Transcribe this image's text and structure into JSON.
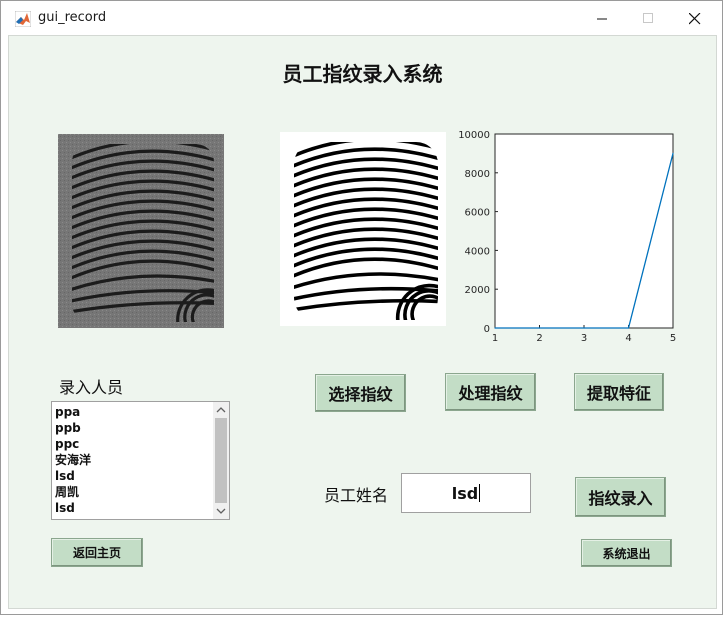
{
  "window": {
    "title": "gui_record"
  },
  "heading": "员工指纹录入系统",
  "buttons": {
    "select": "选择指纹",
    "process": "处理指纹",
    "extract": "提取特征",
    "enroll": "指纹录入",
    "back": "返回主页",
    "exit": "系统退出"
  },
  "labels": {
    "enrolled_staff": "录入人员",
    "employee_name": "员工姓名"
  },
  "name_field": {
    "value": "lsd"
  },
  "staff_list": [
    "ppa",
    "ppb",
    "ppc",
    "安海洋",
    "lsd",
    "周凯",
    "lsd"
  ],
  "chart_data": {
    "type": "line",
    "x": [
      1,
      2,
      3,
      4,
      5
    ],
    "series": [
      {
        "values": [
          0,
          0,
          0,
          0,
          9000
        ],
        "color": "#0072bd"
      }
    ],
    "title": "",
    "xlabel": "",
    "ylabel": "",
    "xlim": [
      1,
      5
    ],
    "ylim": [
      0,
      10000
    ],
    "xticks": [
      "1",
      "2",
      "3",
      "4",
      "5"
    ],
    "yticks": [
      "0",
      "2000",
      "4000",
      "6000",
      "8000",
      "10000"
    ],
    "grid": false,
    "legend": "none"
  }
}
